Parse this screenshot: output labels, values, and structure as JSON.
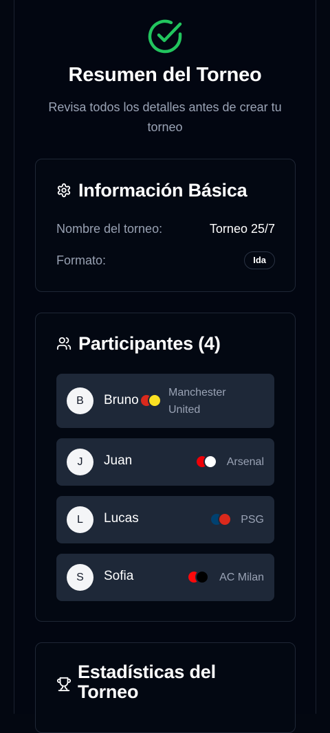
{
  "header": {
    "title": "Resumen del Torneo",
    "subtitle": "Revisa todos los detalles antes de crear tu torneo",
    "status_icon": "check-circle-icon",
    "accent_color": "#22c55e"
  },
  "basic_info": {
    "title": "Información Básica",
    "icon": "gear-icon",
    "name_label": "Nombre del torneo:",
    "name_value": "Torneo 25/7",
    "format_label": "Formato:",
    "format_value": "Ida"
  },
  "participants": {
    "title": "Participantes (4)",
    "icon": "users-icon",
    "items": [
      {
        "initial": "B",
        "name": "Bruno",
        "team": "Manchester United",
        "colors": [
          "#da291c",
          "#fbe122"
        ]
      },
      {
        "initial": "J",
        "name": "Juan",
        "team": "Arsenal",
        "colors": [
          "#ef0107",
          "#ffffff"
        ]
      },
      {
        "initial": "L",
        "name": "Lucas",
        "team": "PSG",
        "colors": [
          "#004170",
          "#da291c"
        ]
      },
      {
        "initial": "S",
        "name": "Sofia",
        "team": "AC Milan",
        "colors": [
          "#fb090b",
          "#000000"
        ]
      }
    ]
  },
  "stats": {
    "title": "Estadísticas del Torneo",
    "icon": "trophy-icon"
  }
}
